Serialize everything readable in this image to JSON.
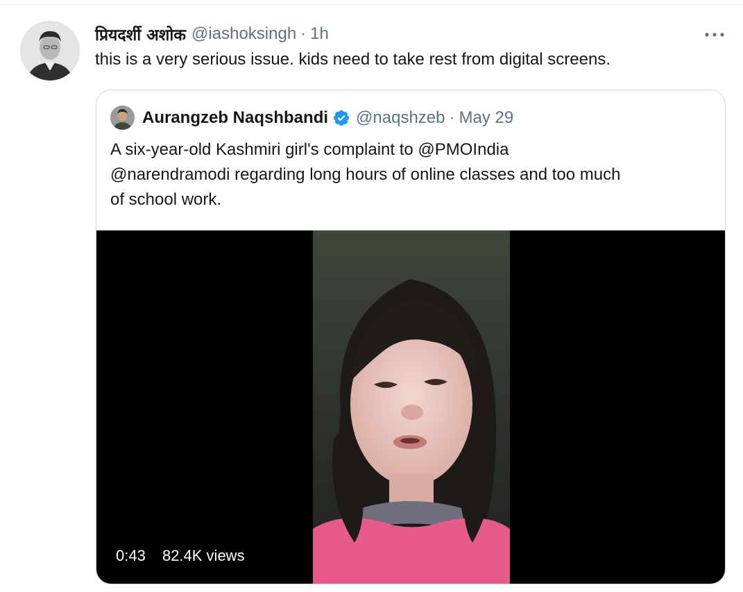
{
  "tweet": {
    "author_name": "प्रियदर्शी अशोक",
    "author_handle": "@iashoksingh",
    "separator": "·",
    "timestamp": "1h",
    "more_icon": "more-horizontal-icon",
    "text": "this is a very serious issue. kids need to take rest from digital screens."
  },
  "quoted_tweet": {
    "author_name": "Aurangzeb Naqshbandi",
    "verified_icon": "verified-badge-icon",
    "verified_color": "#1d9bf0",
    "author_handle": "@naqshzeb",
    "separator": "·",
    "date": "May 29",
    "text_lines": [
      "A six-year-old Kashmiri girl's complaint to @PMOIndia",
      "@narendramodi regarding long hours of online classes and too much",
      "of school work."
    ],
    "video": {
      "duration": "0:43",
      "views": "82.4K views"
    }
  },
  "colors": {
    "text_primary": "#14171a",
    "text_secondary": "#5b7083",
    "border": "#cfd9de"
  }
}
